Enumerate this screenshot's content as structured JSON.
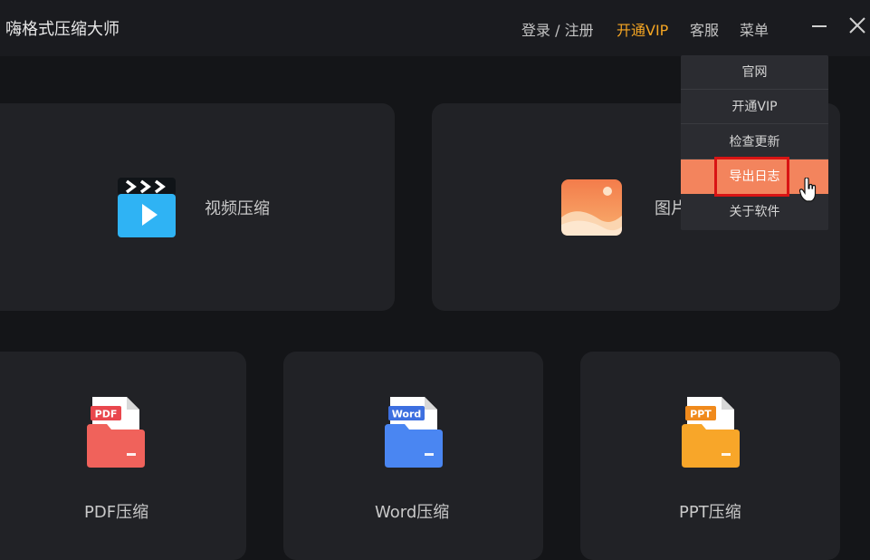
{
  "app": {
    "title": "嗨格式压缩大师"
  },
  "nav": {
    "login": "登录 / 注册",
    "vip": "开通VIP",
    "support": "客服",
    "menu": "菜单"
  },
  "colors": {
    "accent": "#f5a623",
    "menu_hover": "#f3845d",
    "highlight": "#d91414"
  },
  "cards": {
    "video": {
      "label": "视频压缩",
      "icon": "video-clapper-icon"
    },
    "image": {
      "label": "图片",
      "icon": "image-landscape-icon"
    },
    "pdf": {
      "label": "PDF压缩",
      "badge": "PDF",
      "icon": "pdf-folder-icon"
    },
    "word": {
      "label": "Word压缩",
      "badge": "Word",
      "icon": "word-folder-icon"
    },
    "ppt": {
      "label": "PPT压缩",
      "badge": "PPT",
      "icon": "ppt-folder-icon"
    }
  },
  "menu": {
    "items": [
      {
        "label": "官网"
      },
      {
        "label": "开通VIP"
      },
      {
        "label": "检查更新"
      },
      {
        "label": "导出日志"
      },
      {
        "label": "关于软件"
      }
    ]
  }
}
